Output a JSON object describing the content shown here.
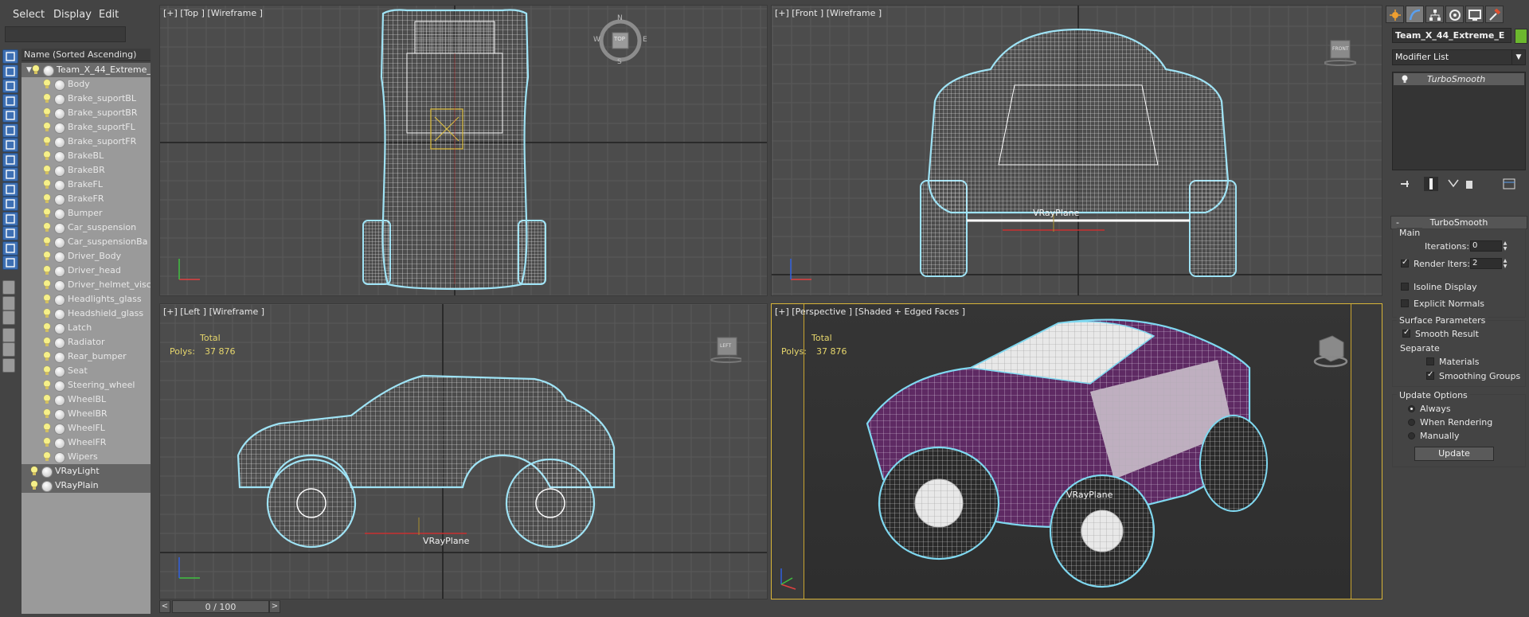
{
  "menu": {
    "select": "Select",
    "display": "Display",
    "edit": "Edit"
  },
  "explorer": {
    "column_header": "Name (Sorted Ascending)",
    "root": "Team_X_44_Extreme_",
    "children": [
      "Body",
      "Brake_suportBL",
      "Brake_suportBR",
      "Brake_suportFL",
      "Brake_suportFR",
      "BrakeBL",
      "BrakeBR",
      "BrakeFL",
      "BrakeFR",
      "Bumper",
      "Car_suspension",
      "Car_suspensionBa",
      "Driver_Body",
      "Driver_head",
      "Driver_helmet_visc",
      "Headlights_glass",
      "Headshield_glass",
      "Latch",
      "Radiator",
      "Rear_bumper",
      "Seat",
      "Steering_wheel",
      "WheelBL",
      "WheelBR",
      "WheelFL",
      "WheelFR",
      "Wipers"
    ],
    "top_level": [
      "VRayLight",
      "VRayPlain"
    ]
  },
  "viewports": {
    "top": {
      "label": "[+] [Top ] [Wireframe ]",
      "cube_text": "TOP",
      "compass": [
        "N",
        "W",
        "E",
        "S"
      ]
    },
    "front": {
      "label": "[+] [Front ] [Wireframe ]",
      "cube_text": "FRONT",
      "plane": "VRayPlane"
    },
    "left": {
      "label": "[+] [Left ] [Wireframe ]",
      "cube_text": "LEFT",
      "plane": "VRayPlane",
      "stats_total": "Total",
      "stats_polys_label": "Polys:",
      "stats_polys_value": "37 876"
    },
    "perspective": {
      "label": "[+] [Perspective ] [Shaded + Edged Faces ]",
      "plane": "VRayPlane",
      "stats_total": "Total",
      "stats_polys_label": "Polys:",
      "stats_polys_value": "37 876"
    }
  },
  "timeline": {
    "text": "0 / 100",
    "prev": "<",
    "next": ">"
  },
  "command_panel": {
    "object_name": "Team_X_44_Extreme_E",
    "object_color": "#6cb82e",
    "modifier_list": "Modifier List",
    "stack_item": "TurboSmooth",
    "rollout_title": "TurboSmooth",
    "main_group": "Main",
    "iterations_label": "Iterations:",
    "iterations_value": "0",
    "render_iters_label": "Render Iters:",
    "render_iters_value": "2",
    "isoline_display": "Isoline Display",
    "explicit_normals": "Explicit Normals",
    "surface_group": "Surface Parameters",
    "smooth_result": "Smooth Result",
    "separate": "Separate",
    "materials": "Materials",
    "smoothing_groups": "Smoothing Groups",
    "update_group": "Update Options",
    "always": "Always",
    "when_rendering": "When Rendering",
    "manually": "Manually",
    "update_button": "Update"
  },
  "colors": {
    "accent_active_viewport": "#d8b438",
    "wire_outline": "#7fd8f0",
    "paint_purple": "#6b2b6e",
    "stats_yellow": "#e6d66c"
  },
  "icons": [
    "select-object-icon",
    "display-filter-icon",
    "light-bulb-icon",
    "sphere-object-icon",
    "sun-create-icon",
    "curve-modify-icon",
    "hierarchy-icon",
    "motion-icon",
    "display-icon",
    "utilities-hammer-icon",
    "pin-stack-icon",
    "show-end-result-icon",
    "make-unique-icon",
    "remove-modifier-icon",
    "configure-sets-icon"
  ]
}
